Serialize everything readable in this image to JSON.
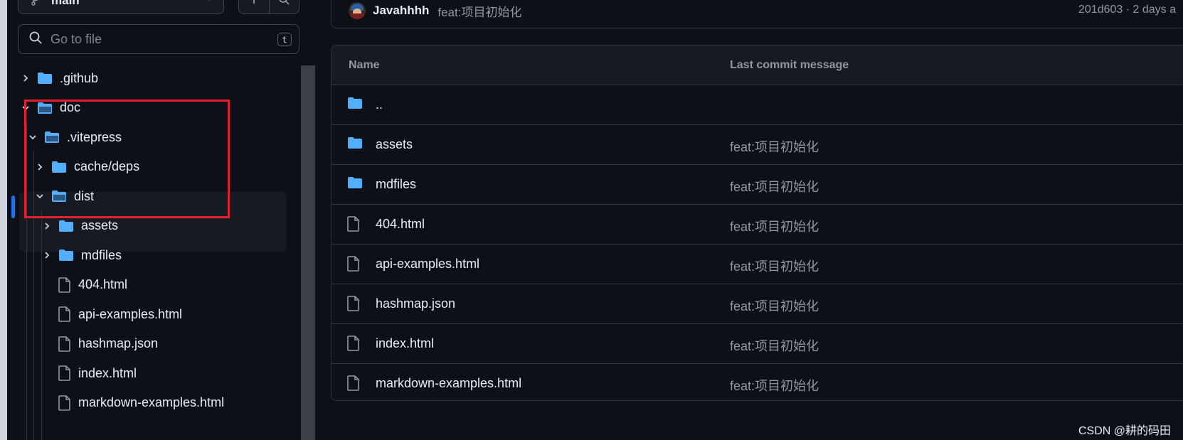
{
  "branch": {
    "label": "main"
  },
  "search": {
    "placeholder": "Go to file",
    "shortcut": "t"
  },
  "tree": {
    "items": [
      {
        "label": ".github",
        "type": "folder",
        "expanded": false
      },
      {
        "label": "doc",
        "type": "folder-open",
        "expanded": true
      },
      {
        "label": ".vitepress",
        "type": "folder-open",
        "expanded": true
      },
      {
        "label": "cache/deps",
        "type": "folder",
        "expanded": false
      },
      {
        "label": "dist",
        "type": "folder-open",
        "expanded": true,
        "selected": true
      },
      {
        "label": "assets",
        "type": "folder",
        "expanded": false
      },
      {
        "label": "mdfiles",
        "type": "folder",
        "expanded": false
      },
      {
        "label": "404.html",
        "type": "file"
      },
      {
        "label": "api-examples.html",
        "type": "file"
      },
      {
        "label": "hashmap.json",
        "type": "file"
      },
      {
        "label": "index.html",
        "type": "file"
      },
      {
        "label": "markdown-examples.html",
        "type": "file"
      }
    ]
  },
  "commit": {
    "author": "Javahhhh",
    "message": "feat:项目初始化",
    "meta": "201d603 · 2 days a"
  },
  "table": {
    "headers": {
      "name": "Name",
      "message": "Last commit message"
    },
    "rows": [
      {
        "name": "..",
        "type": "folder",
        "message": ""
      },
      {
        "name": "assets",
        "type": "folder",
        "message": "feat:项目初始化"
      },
      {
        "name": "mdfiles",
        "type": "folder",
        "message": "feat:项目初始化"
      },
      {
        "name": "404.html",
        "type": "file",
        "message": "feat:项目初始化"
      },
      {
        "name": "api-examples.html",
        "type": "file",
        "message": "feat:项目初始化"
      },
      {
        "name": "hashmap.json",
        "type": "file",
        "message": "feat:项目初始化"
      },
      {
        "name": "index.html",
        "type": "file",
        "message": "feat:项目初始化"
      },
      {
        "name": "markdown-examples.html",
        "type": "file",
        "message": "feat:项目初始化"
      }
    ]
  },
  "watermark": "CSDN @耕的码田",
  "colors": {
    "folder": "#54aeff",
    "accent": "#1f6feb",
    "highlight": "#e5202e"
  }
}
